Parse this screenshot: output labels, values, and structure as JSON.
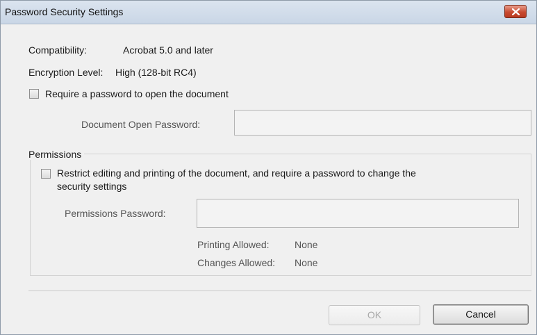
{
  "window": {
    "title": "Password Security Settings"
  },
  "info": {
    "compatibility_label": "Compatibility:",
    "compatibility_value": "Acrobat 5.0 and later",
    "encryption_label": "Encryption Level:",
    "encryption_value": "High (128-bit RC4)"
  },
  "open_password": {
    "checkbox_label": "Require a password to open the document",
    "checked": false,
    "field_label": "Document Open Password:",
    "field_value": ""
  },
  "permissions": {
    "group_title": "Permissions",
    "checkbox_label_line1": "Restrict editing and printing of the document, and require a password to change the",
    "checkbox_label_line2": "security settings",
    "checked": false,
    "password_label": "Permissions Password:",
    "password_value": "",
    "printing_label": "Printing Allowed:",
    "printing_value": "None",
    "changes_label": "Changes Allowed:",
    "changes_value": "None"
  },
  "buttons": {
    "ok_label": "OK",
    "cancel_label": "Cancel"
  },
  "icons": {
    "close": "close-x-icon"
  }
}
